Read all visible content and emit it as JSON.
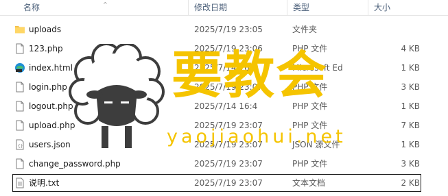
{
  "columns": {
    "name": "名称",
    "date": "修改日期",
    "type": "类型",
    "size": "大小"
  },
  "files": [
    {
      "name": "uploads",
      "date": "2025/7/19 23:05",
      "type": "文件夹",
      "size": "",
      "icon": "folder-icon"
    },
    {
      "name": "123.php",
      "date": "2025/7/19 23:06",
      "type": "PHP 文件",
      "size": "4 KB",
      "icon": "file-icon"
    },
    {
      "name": "index.html",
      "date": "2025/7/14 16:4",
      "type": "Microsoft Ed",
      "size": "1 KB",
      "icon": "edge-html-icon"
    },
    {
      "name": "login.php",
      "date": "2025/7/19 23:07",
      "type": "PHP 文件",
      "size": "3 KB",
      "icon": "file-icon"
    },
    {
      "name": "logout.php",
      "date": "2025/7/14 16:4",
      "type": "PHP 文件",
      "size": "1 KB",
      "icon": "file-icon"
    },
    {
      "name": "upload.php",
      "date": "2025/7/19 23:07",
      "type": "PHP 文件",
      "size": "7 KB",
      "icon": "file-icon"
    },
    {
      "name": "users.json",
      "date": "2025/7/19 23:07",
      "type": "JSON 源文件",
      "size": "1 KB",
      "icon": "json-file-icon"
    },
    {
      "name": "change_password.php",
      "date": "2025/7/19 23:07",
      "type": "PHP 文件",
      "size": "3 KB",
      "icon": "file-icon"
    },
    {
      "name": "说明.txt",
      "date": "2025/7/19 23:07",
      "type": "文本文档",
      "size": "2 KB",
      "icon": "text-file-icon"
    }
  ],
  "selected_index": 8,
  "watermark": {
    "brand": "要教会",
    "url": "yaojiaohui.net",
    "color": "#f5c400"
  }
}
